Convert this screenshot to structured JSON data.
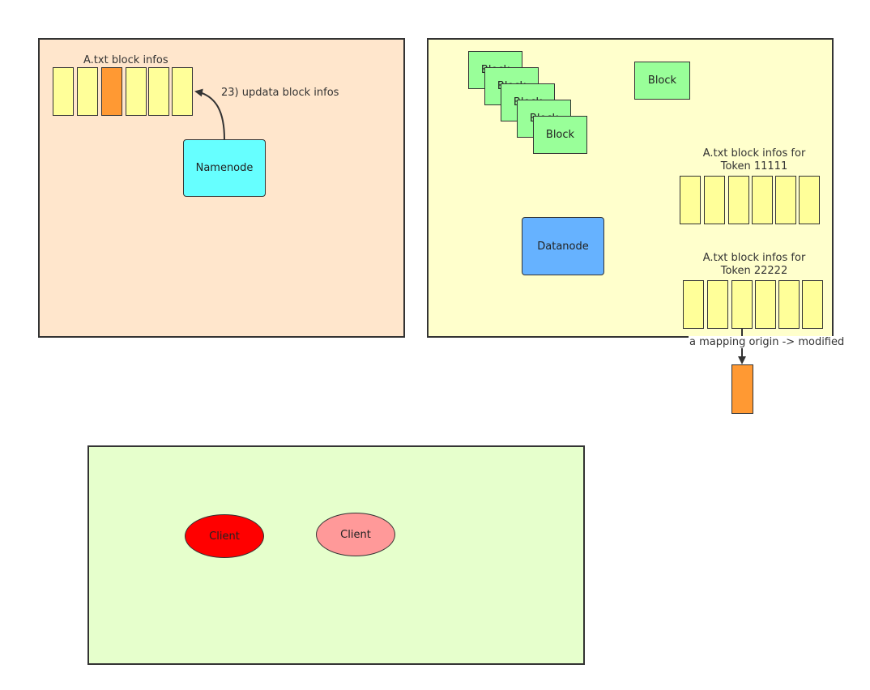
{
  "colors": {
    "namenode_panel": "#FFE6CC",
    "datanode_panel": "#FFFFCC",
    "client_panel": "#E6FFCC",
    "cell_fill": "#FFFF99",
    "cell_highlight": "#FF9933",
    "namenode": "#66FFFF",
    "datanode": "#66B2FF",
    "block": "#99FF99",
    "client_active": "#FF0000",
    "client_light": "#FF9999",
    "stroke": "#333333"
  },
  "namenode_panel": {
    "block_infos_title": "A.txt block infos",
    "cells": [
      {
        "state": "normal"
      },
      {
        "state": "normal"
      },
      {
        "state": "modified"
      },
      {
        "state": "normal"
      },
      {
        "state": "normal"
      },
      {
        "state": "normal"
      }
    ],
    "update_label": "23) updata block infos",
    "namenode_label": "Namenode"
  },
  "datanode_panel": {
    "stacked_block_labels": [
      "Block",
      "Block",
      "Block",
      "Block",
      "Block"
    ],
    "single_block_label": "Block",
    "datanode_label": "Datanode",
    "token1": {
      "title_line1": "A.txt block infos for",
      "title_line2": "Token 11111",
      "cell_count": 6
    },
    "token2": {
      "title_line1": "A.txt block infos for",
      "title_line2": "Token 22222",
      "cell_count": 6
    }
  },
  "mapping_label": "a mapping origin -> modified",
  "client_panel": {
    "clients": [
      "Client",
      "Client"
    ]
  }
}
